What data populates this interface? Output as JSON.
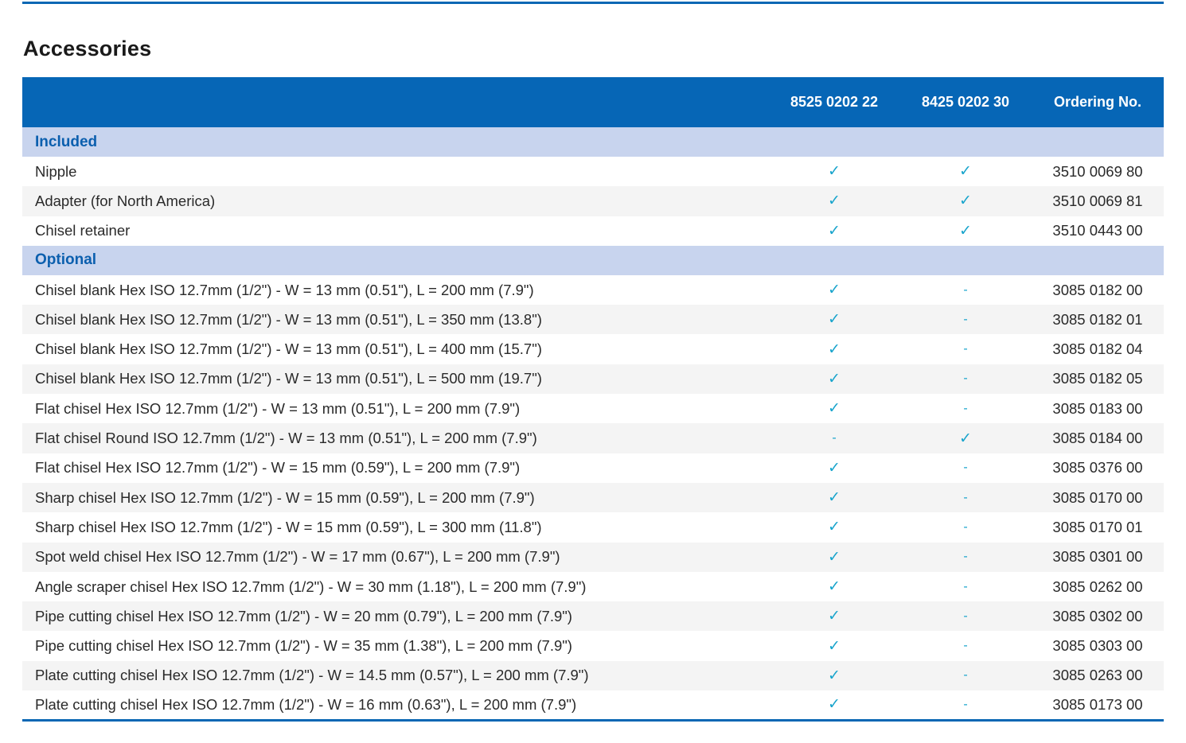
{
  "title": "Accessories",
  "columns": {
    "description": "",
    "model_a": "8525 0202 22",
    "model_b": "8425 0202 30",
    "ordering": "Ordering No."
  },
  "sections": [
    {
      "label": "Included",
      "rows": [
        {
          "description": "Nipple",
          "model_a": "✓",
          "model_b": "✓",
          "ordering": "3510 0069 80"
        },
        {
          "description": "Adapter (for North America)",
          "model_a": "✓",
          "model_b": "✓",
          "ordering": "3510 0069 81"
        },
        {
          "description": "Chisel retainer",
          "model_a": "✓",
          "model_b": "✓",
          "ordering": "3510 0443 00"
        }
      ]
    },
    {
      "label": "Optional",
      "rows": [
        {
          "description": "Chisel blank Hex ISO 12.7mm (1/2\") - W = 13 mm (0.51\"), L = 200 mm (7.9\")",
          "model_a": "✓",
          "model_b": "-",
          "ordering": "3085 0182 00"
        },
        {
          "description": "Chisel blank Hex ISO 12.7mm (1/2\") - W = 13 mm (0.51\"), L = 350 mm (13.8\")",
          "model_a": "✓",
          "model_b": "-",
          "ordering": "3085 0182 01"
        },
        {
          "description": "Chisel blank Hex ISO 12.7mm (1/2\") - W = 13 mm (0.51\"), L = 400 mm (15.7\")",
          "model_a": "✓",
          "model_b": "-",
          "ordering": "3085 0182 04"
        },
        {
          "description": "Chisel blank Hex ISO 12.7mm (1/2\") - W = 13 mm (0.51\"), L = 500 mm (19.7\")",
          "model_a": "✓",
          "model_b": "-",
          "ordering": "3085 0182 05"
        },
        {
          "description": "Flat chisel Hex ISO 12.7mm (1/2\") - W = 13 mm (0.51\"), L = 200 mm (7.9\")",
          "model_a": "✓",
          "model_b": "-",
          "ordering": "3085 0183 00"
        },
        {
          "description": "Flat chisel Round ISO 12.7mm (1/2\") - W = 13 mm (0.51\"), L = 200 mm (7.9\")",
          "model_a": "-",
          "model_b": "✓",
          "ordering": "3085 0184 00"
        },
        {
          "description": "Flat chisel Hex ISO 12.7mm (1/2\") - W = 15 mm (0.59\"), L = 200 mm (7.9\")",
          "model_a": "✓",
          "model_b": "-",
          "ordering": "3085 0376 00"
        },
        {
          "description": "Sharp chisel Hex ISO 12.7mm (1/2\") - W = 15 mm (0.59\"), L = 200 mm (7.9\")",
          "model_a": "✓",
          "model_b": "-",
          "ordering": "3085 0170 00"
        },
        {
          "description": "Sharp chisel Hex ISO 12.7mm (1/2\") - W = 15 mm (0.59\"), L = 300 mm (11.8\")",
          "model_a": "✓",
          "model_b": "-",
          "ordering": "3085 0170 01"
        },
        {
          "description": "Spot weld chisel Hex ISO 12.7mm (1/2\") - W = 17 mm (0.67\"), L = 200 mm (7.9\")",
          "model_a": "✓",
          "model_b": "-",
          "ordering": "3085 0301 00"
        },
        {
          "description": "Angle scraper chisel Hex ISO 12.7mm (1/2\") - W = 30 mm (1.18\"), L = 200 mm (7.9\")",
          "model_a": "✓",
          "model_b": "-",
          "ordering": "3085 0262 00"
        },
        {
          "description": "Pipe cutting chisel Hex ISO 12.7mm (1/2\") - W = 20 mm (0.79\"), L = 200 mm (7.9\")",
          "model_a": "✓",
          "model_b": "-",
          "ordering": "3085 0302 00"
        },
        {
          "description": "Pipe cutting chisel Hex ISO 12.7mm (1/2\") - W = 35 mm (1.38\"), L = 200 mm (7.9\")",
          "model_a": "✓",
          "model_b": "-",
          "ordering": "3085 0303 00"
        },
        {
          "description": "Plate cutting chisel Hex ISO 12.7mm (1/2\") - W = 14.5 mm (0.57\"), L = 200 mm (7.9\")",
          "model_a": "✓",
          "model_b": "-",
          "ordering": "3085 0263 00"
        },
        {
          "description": "Plate cutting chisel Hex ISO 12.7mm (1/2\") - W = 16 mm (0.63\"), L = 200 mm (7.9\")",
          "model_a": "✓",
          "model_b": "-",
          "ordering": "3085 0173 00"
        }
      ]
    }
  ],
  "colors": {
    "header_bg": "#0666b6",
    "section_bg": "#c8d4ee",
    "section_text": "#0b5fae",
    "check_mark": "#18a4cc",
    "rule": "#0967b4"
  }
}
